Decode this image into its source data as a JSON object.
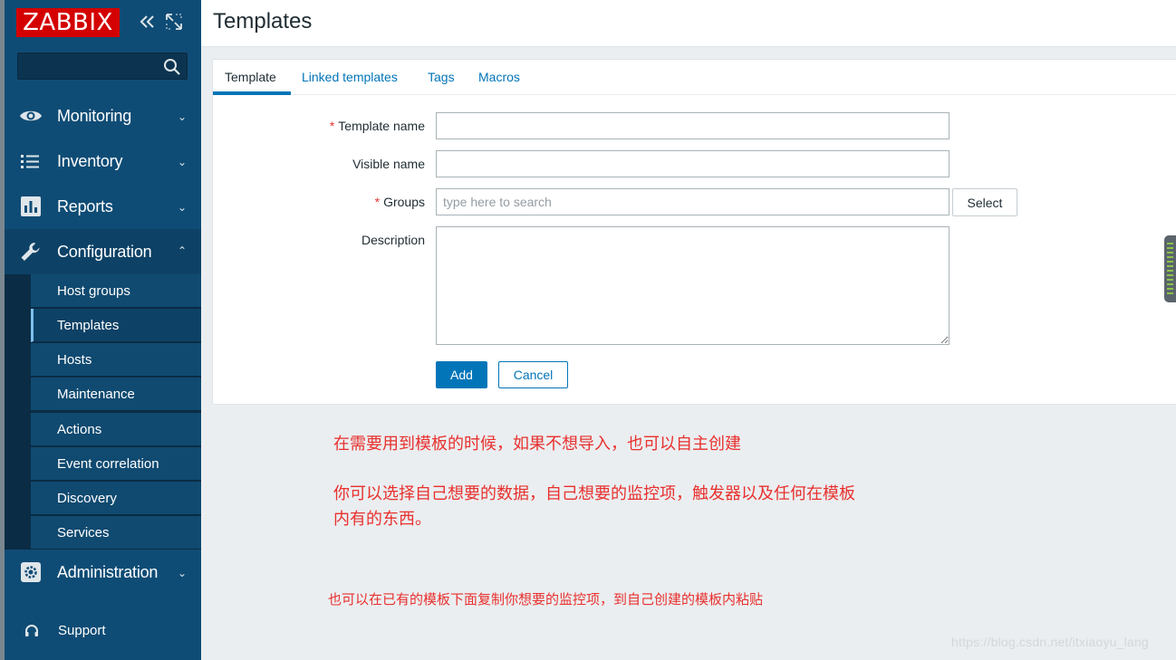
{
  "app": {
    "logo_text": "ZABBIX",
    "brand_color": "#d40000",
    "sidebar_color": "#0f4c75",
    "accent_color": "#0275b8"
  },
  "sidebar": {
    "search_placeholder": "",
    "menus": [
      {
        "label": "Monitoring",
        "icon": "eye-icon",
        "expanded": false
      },
      {
        "label": "Inventory",
        "icon": "list-icon",
        "expanded": false
      },
      {
        "label": "Reports",
        "icon": "bar-chart-icon",
        "expanded": false
      },
      {
        "label": "Configuration",
        "icon": "wrench-icon",
        "expanded": true
      },
      {
        "label": "Administration",
        "icon": "gear-icon",
        "expanded": false
      }
    ],
    "config_items": [
      {
        "label": "Host groups",
        "selected": false
      },
      {
        "label": "Templates",
        "selected": true
      },
      {
        "label": "Hosts",
        "selected": false
      },
      {
        "label": "Maintenance",
        "selected": false
      },
      {
        "label": "Actions",
        "selected": false
      },
      {
        "label": "Event correlation",
        "selected": false
      },
      {
        "label": "Discovery",
        "selected": false
      },
      {
        "label": "Services",
        "selected": false
      }
    ],
    "support_label": "Support"
  },
  "header": {
    "title": "Templates"
  },
  "tabs": [
    {
      "label": "Template",
      "active": true
    },
    {
      "label": "Linked templates",
      "active": false
    },
    {
      "label": "Tags",
      "active": false
    },
    {
      "label": "Macros",
      "active": false
    }
  ],
  "form": {
    "template_name_label": "Template name",
    "template_name_value": "",
    "visible_name_label": "Visible name",
    "visible_name_value": "",
    "groups_label": "Groups",
    "groups_placeholder": "type here to search",
    "description_label": "Description",
    "description_value": "",
    "select_label": "Select",
    "add_label": "Add",
    "cancel_label": "Cancel",
    "required_marker": "*"
  },
  "annotations": {
    "note1": "在需要用到模板的时候，如果不想导入，也可以自主创建",
    "note2_line1": "你可以选择自己想要的数据，自己想要的监控项，触发器以及任何在模板",
    "note2_line2": "内有的东西。",
    "note3": "也可以在已有的模板下面复制你想要的监控项，到自己创建的模板内粘贴",
    "color": "#e8302e"
  },
  "watermark": "https://blog.csdn.net/itxiaoyu_lang"
}
